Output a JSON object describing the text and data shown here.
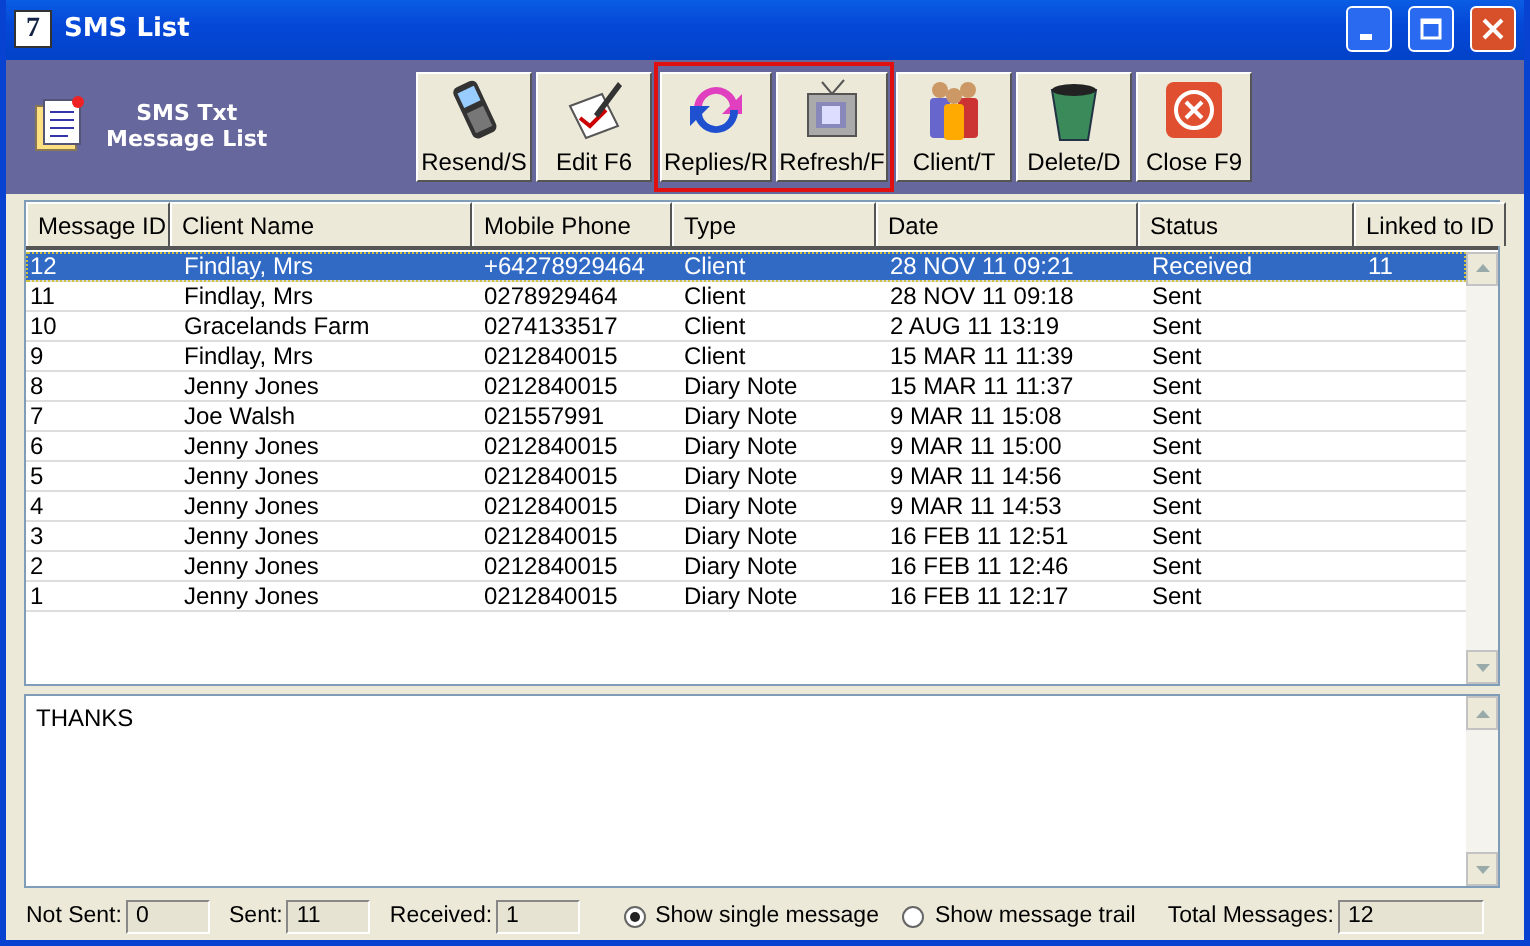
{
  "window": {
    "title": "SMS List",
    "app_icon": "7"
  },
  "header": {
    "title_line1": "SMS Txt",
    "title_line2": "Message List"
  },
  "toolbar": [
    {
      "label": "Resend/S",
      "kind": "phone",
      "highlighted": false
    },
    {
      "label": "Edit F6",
      "kind": "edit",
      "highlighted": false
    },
    {
      "label": "Replies/R",
      "kind": "replies",
      "highlighted": true
    },
    {
      "label": "Refresh/F",
      "kind": "refresh",
      "highlighted": true
    },
    {
      "label": "Client/T",
      "kind": "client",
      "highlighted": false
    },
    {
      "label": "Delete/D",
      "kind": "delete",
      "highlighted": false
    },
    {
      "label": "Close F9",
      "kind": "close",
      "highlighted": false
    }
  ],
  "table": {
    "columns": [
      "Message ID",
      "Client Name",
      "Mobile Phone",
      "Type",
      "Date",
      "Status",
      "Linked to ID"
    ],
    "rows": [
      {
        "selected": true,
        "cells": [
          "12",
          "Findlay, Mrs",
          "+64278929464",
          "Client",
          "28 NOV 11  09:21",
          "Received",
          "11"
        ]
      },
      {
        "selected": false,
        "cells": [
          "11",
          "Findlay, Mrs",
          "0278929464",
          "Client",
          "28 NOV 11  09:18",
          "Sent",
          ""
        ]
      },
      {
        "selected": false,
        "cells": [
          "10",
          "Gracelands Farm",
          "0274133517",
          "Client",
          "2 AUG 11  13:19",
          "Sent",
          ""
        ]
      },
      {
        "selected": false,
        "cells": [
          "9",
          "Findlay, Mrs",
          "0212840015",
          "Client",
          "15 MAR 11  11:39",
          "Sent",
          ""
        ]
      },
      {
        "selected": false,
        "cells": [
          "8",
          "Jenny Jones",
          "0212840015",
          "Diary Note",
          "15 MAR 11  11:37",
          "Sent",
          ""
        ]
      },
      {
        "selected": false,
        "cells": [
          "7",
          "Joe Walsh",
          "021557991",
          "Diary Note",
          "9 MAR 11  15:08",
          "Sent",
          ""
        ]
      },
      {
        "selected": false,
        "cells": [
          "6",
          "Jenny Jones",
          "0212840015",
          "Diary Note",
          "9 MAR 11  15:00",
          "Sent",
          ""
        ]
      },
      {
        "selected": false,
        "cells": [
          "5",
          "Jenny Jones",
          "0212840015",
          "Diary Note",
          "9 MAR 11  14:56",
          "Sent",
          ""
        ]
      },
      {
        "selected": false,
        "cells": [
          "4",
          "Jenny Jones",
          "0212840015",
          "Diary Note",
          "9 MAR 11  14:53",
          "Sent",
          ""
        ]
      },
      {
        "selected": false,
        "cells": [
          "3",
          "Jenny Jones",
          "0212840015",
          "Diary Note",
          "16 FEB 11  12:51",
          "Sent",
          ""
        ]
      },
      {
        "selected": false,
        "cells": [
          "2",
          "Jenny Jones",
          "0212840015",
          "Diary Note",
          "16 FEB 11  12:46",
          "Sent",
          ""
        ]
      },
      {
        "selected": false,
        "cells": [
          "1",
          "Jenny Jones",
          "0212840015",
          "Diary Note",
          "16 FEB 11  12:17",
          "Sent",
          ""
        ]
      }
    ]
  },
  "message": {
    "text": "THANKS"
  },
  "footer": {
    "counts": [
      {
        "label": "Not Sent:",
        "value": "0"
      },
      {
        "label": "Sent:",
        "value": "11"
      },
      {
        "label": "Received:",
        "value": "1"
      }
    ],
    "options": [
      {
        "label": "Show single message",
        "selected": true
      },
      {
        "label": "Show message trail",
        "selected": false
      }
    ],
    "total": {
      "label": "Total Messages:",
      "value": "12"
    }
  }
}
